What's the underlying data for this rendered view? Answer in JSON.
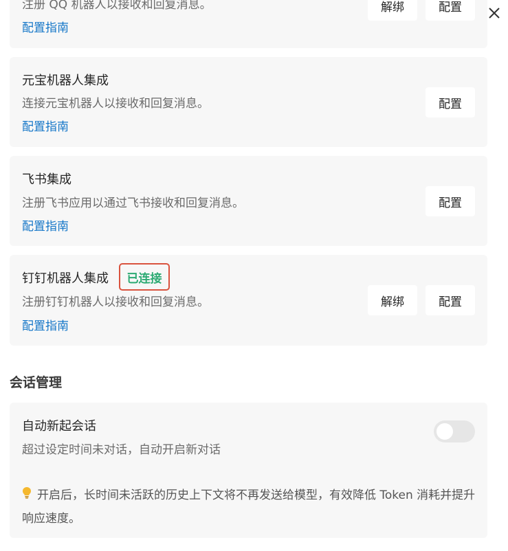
{
  "integrations": {
    "qq": {
      "description": "注册 QQ 机器人以接收和回复消息。",
      "guide_label": "配置指南",
      "unbind_label": "解绑",
      "config_label": "配置"
    },
    "yuanbao": {
      "title": "元宝机器人集成",
      "description": "连接元宝机器人以接收和回复消息。",
      "guide_label": "配置指南",
      "config_label": "配置"
    },
    "feishu": {
      "title": "飞书集成",
      "description": "注册飞书应用以通过飞书接收和回复消息。",
      "guide_label": "配置指南",
      "config_label": "配置"
    },
    "dingtalk": {
      "title": "钉钉机器人集成",
      "status_badge": "已连接",
      "description": "注册钉钉机器人以接收和回复消息。",
      "guide_label": "配置指南",
      "unbind_label": "解绑",
      "config_label": "配置"
    }
  },
  "session_management": {
    "section_title": "会话管理",
    "auto_new_session": {
      "title": "自动新起会话",
      "description": "超过设定时间未对话，自动开启新对话",
      "toggle_on": false,
      "tip_icon": "lightbulb-icon",
      "tip_text": "开启后，长时间未活跃的历史上下文将不再发送给模型，有效降低 Token 消耗并提升响应速度。"
    }
  },
  "colors": {
    "link": "#1677c8",
    "connected": "#2daa73",
    "highlight_border": "#d9523e",
    "card_bg": "#f7f7f7"
  }
}
